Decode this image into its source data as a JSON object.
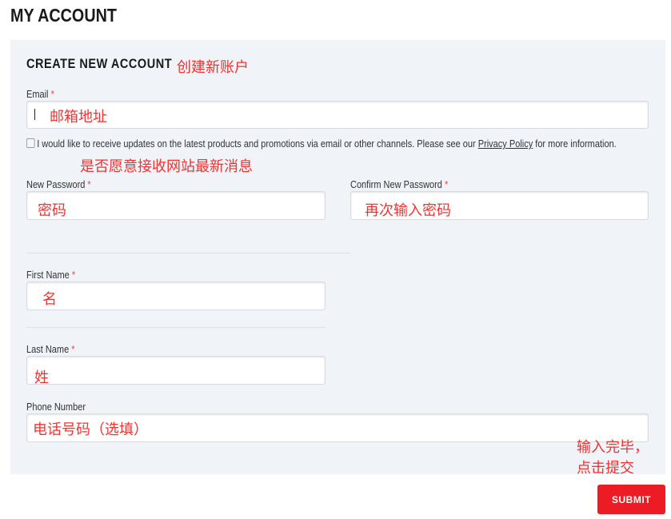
{
  "page": {
    "title": "MY ACCOUNT"
  },
  "form": {
    "section_title": "CREATE NEW ACCOUNT",
    "section_annotation": "创建新账户",
    "required_mark": "*",
    "email": {
      "label": "Email",
      "annotation": "邮箱地址",
      "value": ""
    },
    "consent": {
      "text_before": "I would like to receive updates on the latest products and promotions via email or other channels. Please see our ",
      "link_text": "Privacy Policy",
      "text_after": " for more information.",
      "annotation": "是否愿意接收网站最新消息",
      "checked": false
    },
    "new_password": {
      "label": "New Password",
      "annotation": "密码",
      "value": ""
    },
    "confirm_password": {
      "label": "Confirm New Password",
      "annotation": "再次输入密码",
      "value": ""
    },
    "first_name": {
      "label": "First Name",
      "annotation": "名",
      "value": ""
    },
    "last_name": {
      "label": "Last Name",
      "annotation": "姓",
      "value": ""
    },
    "phone": {
      "label": "Phone Number",
      "annotation": "电话号码（选填）",
      "value": ""
    },
    "submit_annotation_line1": "输入完毕，",
    "submit_annotation_line2": "点击提交",
    "submit_label": "SUBMIT"
  },
  "colors": {
    "accent": "#ed1c24",
    "panel_bg": "#f0f3f7",
    "annotation": "#ee3333",
    "required": "#e8474b"
  }
}
